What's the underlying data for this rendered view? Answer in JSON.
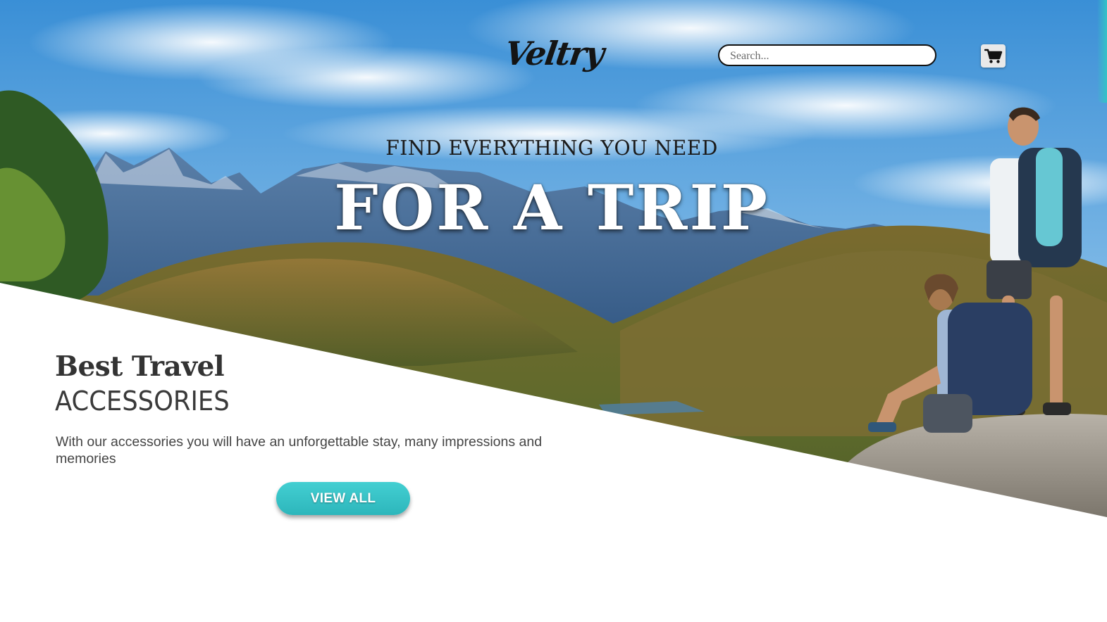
{
  "header": {
    "logo_text": "Veltry",
    "search": {
      "placeholder": "Search..."
    },
    "cart_icon": "shopping-cart-icon"
  },
  "hero": {
    "kicker": "FIND EVERYTHING YOU NEED",
    "headline": "FOR A TRIP"
  },
  "promo": {
    "title": "Best Travel",
    "subtitle": "ACCESSORIES",
    "description": "With our accessories you will have an unforgettable stay, many impressions and memories",
    "button_label": "VIEW ALL"
  },
  "colors": {
    "accent": "#33c3c7",
    "text_dark": "#333333"
  }
}
